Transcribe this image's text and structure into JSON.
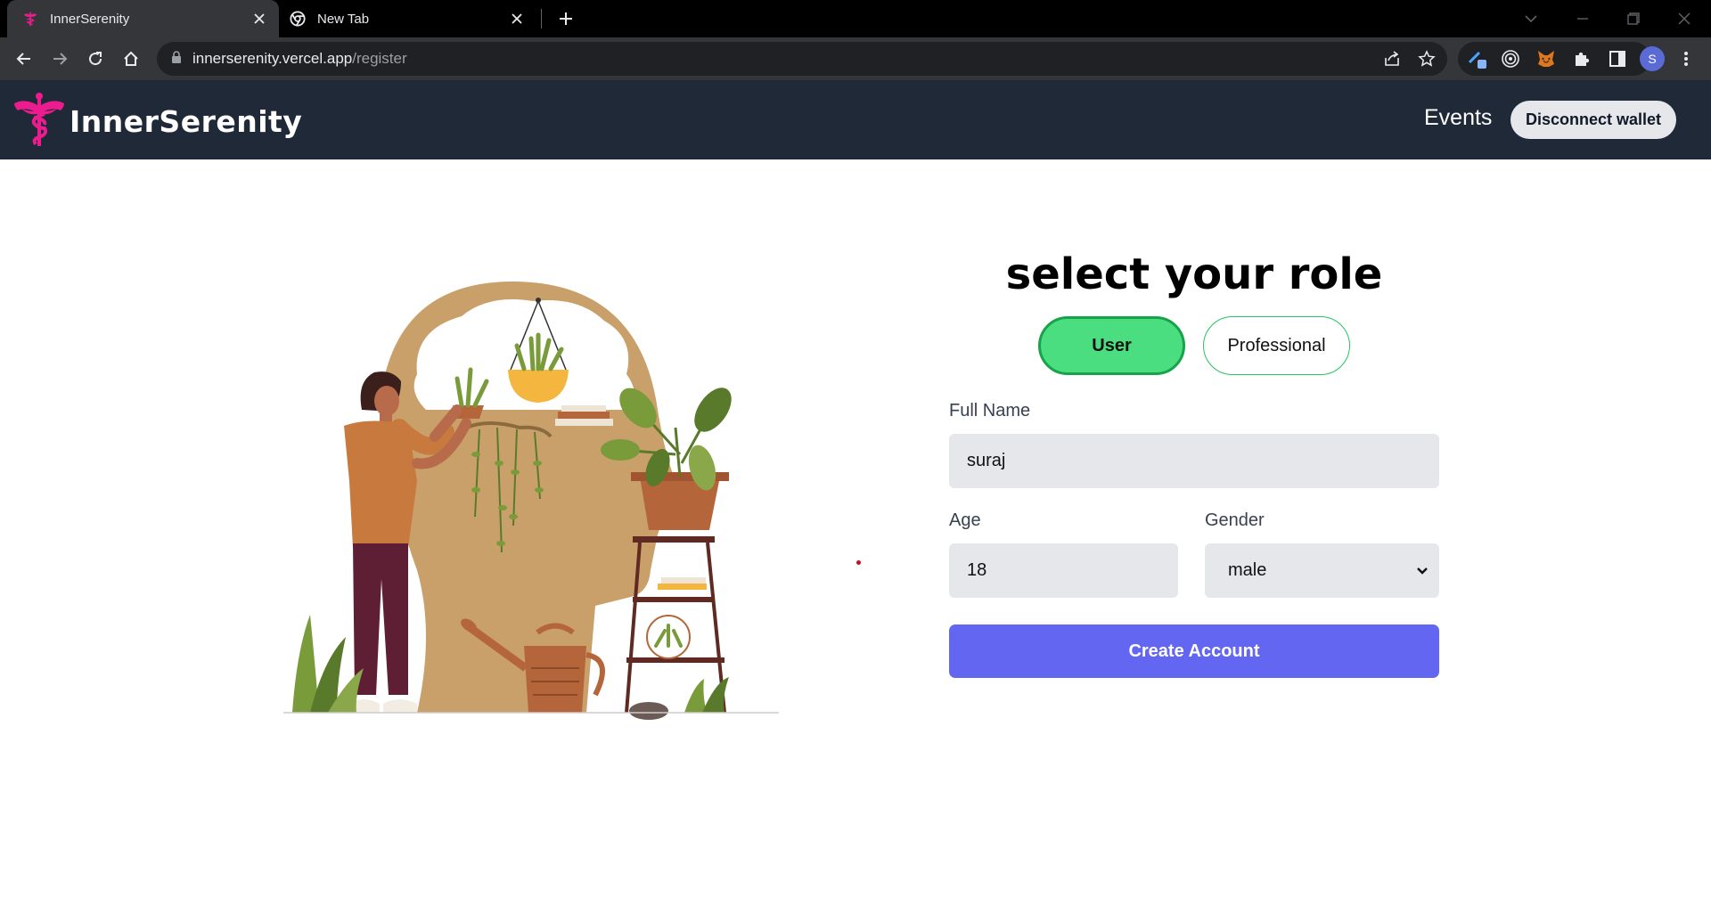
{
  "browser": {
    "tabs": [
      {
        "title": "InnerSerenity",
        "active": true,
        "favicon": "caduceus-icon"
      },
      {
        "title": "New Tab",
        "active": false,
        "favicon": "chrome-icon"
      }
    ],
    "address": {
      "host": "innerserenity.vercel.app",
      "path": "/register"
    },
    "avatar_letter": "S",
    "colors": {
      "tabstrip": "#000000",
      "toolbar": "#35363a",
      "omnibox": "#202124"
    }
  },
  "nav": {
    "brand": "InnerSerenity",
    "events_link": "Events",
    "disconnect_button": "Disconnect wallet",
    "colors": {
      "background": "#1f2937",
      "logo": "#ec1c8e"
    }
  },
  "form": {
    "title": "select your role",
    "roles": [
      {
        "label": "User",
        "selected": true
      },
      {
        "label": "Professional",
        "selected": false
      }
    ],
    "full_name": {
      "label": "Full Name",
      "value": "suraj"
    },
    "age": {
      "label": "Age",
      "value": "18"
    },
    "gender": {
      "label": "Gender",
      "value": "male"
    },
    "submit_label": "Create Account",
    "colors": {
      "selected_role": "#4ade80",
      "submit": "#6366f1",
      "field_bg": "#e5e7eb"
    }
  }
}
